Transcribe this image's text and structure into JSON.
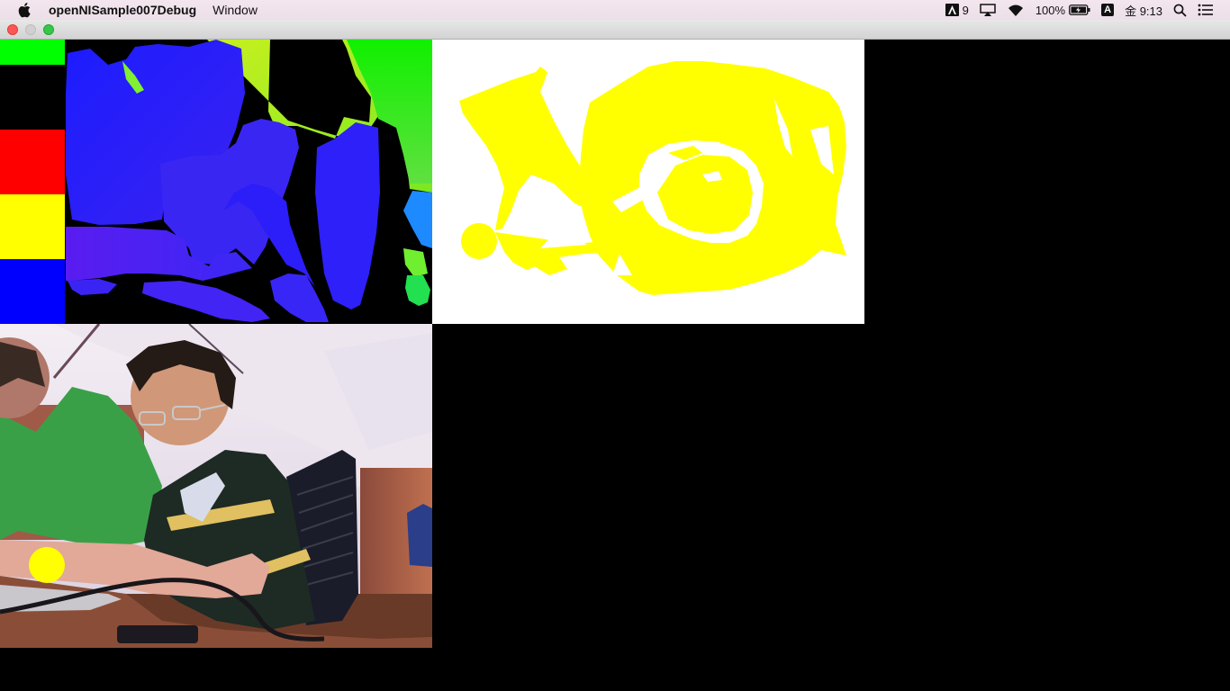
{
  "menubar": {
    "app_name": "openNISample007Debug",
    "menu_window": "Window",
    "adobe_count": "9",
    "battery": "100%",
    "input_source": "A",
    "clock": "金 9:13"
  },
  "colors": {
    "menubar_bg": "#efe2eb",
    "depth_bg": "#000000",
    "sketch_bg": "#ffffff",
    "sketch_shape": "#ffff00",
    "marker": "#ffff00",
    "swatch_green": "#00ff00",
    "swatch_black": "#000000",
    "swatch_red": "#ff0000",
    "swatch_yellow": "#ffff00",
    "swatch_blue": "#0000ff"
  },
  "icons": [
    "apple-icon",
    "adobe-icon",
    "airplay-icon",
    "wifi-icon",
    "battery-icon",
    "input-source-icon",
    "spotlight-search-icon",
    "notification-center-icon"
  ]
}
